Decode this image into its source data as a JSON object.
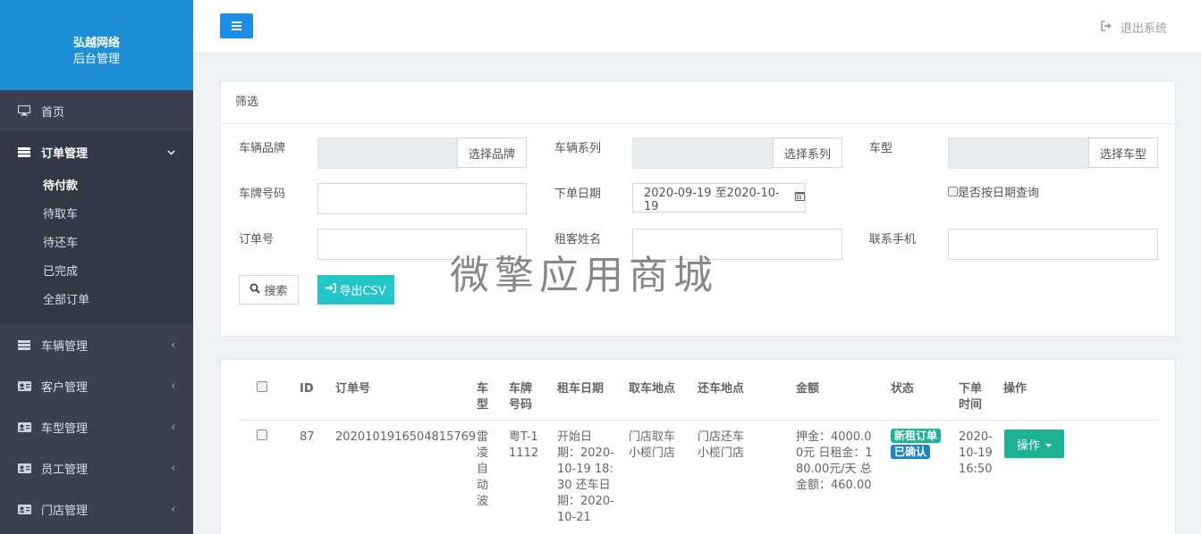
{
  "brand": {
    "line1": "弘越网络",
    "line2": "后台管理",
    "color": "#1e8fd6"
  },
  "sidebar": {
    "items": [
      {
        "label": "首页",
        "icon": "monitor-icon"
      },
      {
        "label": "订单管理",
        "icon": "list-icon",
        "expanded": true
      },
      {
        "label": "车辆管理",
        "icon": "list-icon"
      },
      {
        "label": "客户管理",
        "icon": "id-card-icon"
      },
      {
        "label": "车型管理",
        "icon": "id-card-icon"
      },
      {
        "label": "员工管理",
        "icon": "id-card-icon"
      },
      {
        "label": "门店管理",
        "icon": "id-card-icon"
      }
    ],
    "order_sub": [
      "待付款",
      "待取车",
      "待还车",
      "已完成",
      "全部订单"
    ]
  },
  "topbar": {
    "logout": "退出系统"
  },
  "filter": {
    "title": "筛选",
    "brand_label": "车辆品牌",
    "brand_btn": "选择品牌",
    "series_label": "车辆系列",
    "series_btn": "选择系列",
    "model_label": "车型",
    "model_btn": "选择车型",
    "plate_label": "车牌号码",
    "date_label": "下单日期",
    "date_value": "2020-09-19 至2020-10-19",
    "by_date_label": "是否按日期查询",
    "order_no_label": "订单号",
    "renter_label": "租客姓名",
    "phone_label": "联系手机",
    "search_btn": "搜索",
    "export_btn": "导出CSV"
  },
  "watermark": "微擎应用商城",
  "table": {
    "headers": {
      "id": "ID",
      "order_no": "订单号",
      "model": "车型",
      "plate": "车牌号码",
      "rent_date": "租车日期",
      "pickup": "取车地点",
      "return": "还车地点",
      "amount": "金额",
      "status": "状态",
      "order_time": "下单时间",
      "action": "操作"
    },
    "row": {
      "id": "87",
      "order_no": "2020101916504815769",
      "model": "雷凌自动波",
      "plate": "粤T-11112",
      "rent_date": "开始日期：2020-10-19 18:30 还车日期：2020-10-21",
      "pickup": "门店取车 小榄门店",
      "return": "门店还车 小榄门店",
      "amount": "押金：4000.00元 日租金：180.00元/天 总金额：460.00",
      "status1": "新租订单",
      "status2": "已确认",
      "order_time": "2020-10-19 16:50",
      "action": "操作"
    },
    "colors": {
      "status1": "#1bb394",
      "status2": "#1c84c6",
      "action": "#1bb394"
    }
  }
}
